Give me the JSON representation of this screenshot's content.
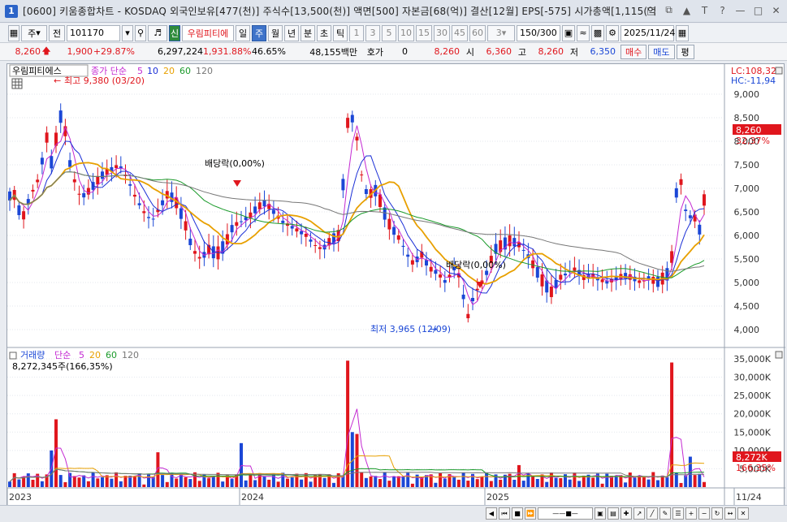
{
  "window": {
    "number": "1",
    "title": "[0600] 키움종합차트 - KOSDAQ 외국인보유[477(천)] 주식수[13,500(천)] 액면[500] 자본금[68(억)] 결산[12월] EPS[-575] 시가총액[1,115(억"
  },
  "toolbar": {
    "market": "주",
    "sel2": "전",
    "code": "101170",
    "new_badge": "신",
    "stock_name": "우림피티에",
    "periods": [
      "일",
      "주",
      "월",
      "년",
      "분",
      "초",
      "틱"
    ],
    "minutes": [
      "1",
      "3",
      "5",
      "10",
      "15",
      "30",
      "45",
      "60"
    ],
    "interval": "3",
    "count": "150",
    "count_total": "/300",
    "date": "2025/11/24"
  },
  "info": {
    "price": "8,260",
    "change": "1,900",
    "change_pct": "+29.87%",
    "volume": "6,297,224",
    "vol_pct": "1,931.88%",
    "ratio": "46.65%",
    "amount": "48,155백만",
    "hoga_label": "호가",
    "hoga": "0",
    "hoga_price": "8,260",
    "open_label": "시",
    "open": "6,360",
    "high_label": "고",
    "high": "8,260",
    "low_label": "저",
    "low": "6,350",
    "buy": "매수",
    "sell": "매도",
    "eval": "평"
  },
  "price_legend": {
    "name": "우림피티에스",
    "ma_label": "종가 단순",
    "ma": [
      "5",
      "10",
      "20",
      "60",
      "120"
    ]
  },
  "annotations": {
    "high": "최고 9,380 (03/20)",
    "low": "최저 3,965 (12/09)",
    "div1": "배당락(0,00%)",
    "div2": "배당락(0,00%)",
    "lc": "LC:108,32",
    "hc": "HC:-11,94",
    "last_price": "8,260",
    "last_pct": "32,37%"
  },
  "volume_legend": {
    "label": "거래량",
    "ma_label": "단순",
    "ma": [
      "5",
      "20",
      "60",
      "120"
    ],
    "value": "8,272,345주(166,35%)",
    "last": "8,272K",
    "last_pct": "166,35%"
  },
  "chart_data": {
    "type": "candlestick",
    "price_axis": [
      "9,000",
      "8,500",
      "8,000",
      "7,500",
      "7,000",
      "6,500",
      "6,000",
      "5,500",
      "5,000",
      "4,500",
      "4,000"
    ],
    "volume_axis": [
      "35,000K",
      "30,000K",
      "25,000K",
      "20,000K",
      "15,000K",
      "10,000K",
      "5,000K"
    ],
    "x_labels": [
      "2023",
      "2024",
      "2025",
      "11/24"
    ],
    "colors": {
      "up": "#e0161d",
      "down": "#1b47d6",
      "ma5": "#c42ad2",
      "ma10": "#1b2fd6",
      "ma20": "#e8a000",
      "ma60": "#1a9a2a",
      "ma120": "#777777"
    }
  }
}
